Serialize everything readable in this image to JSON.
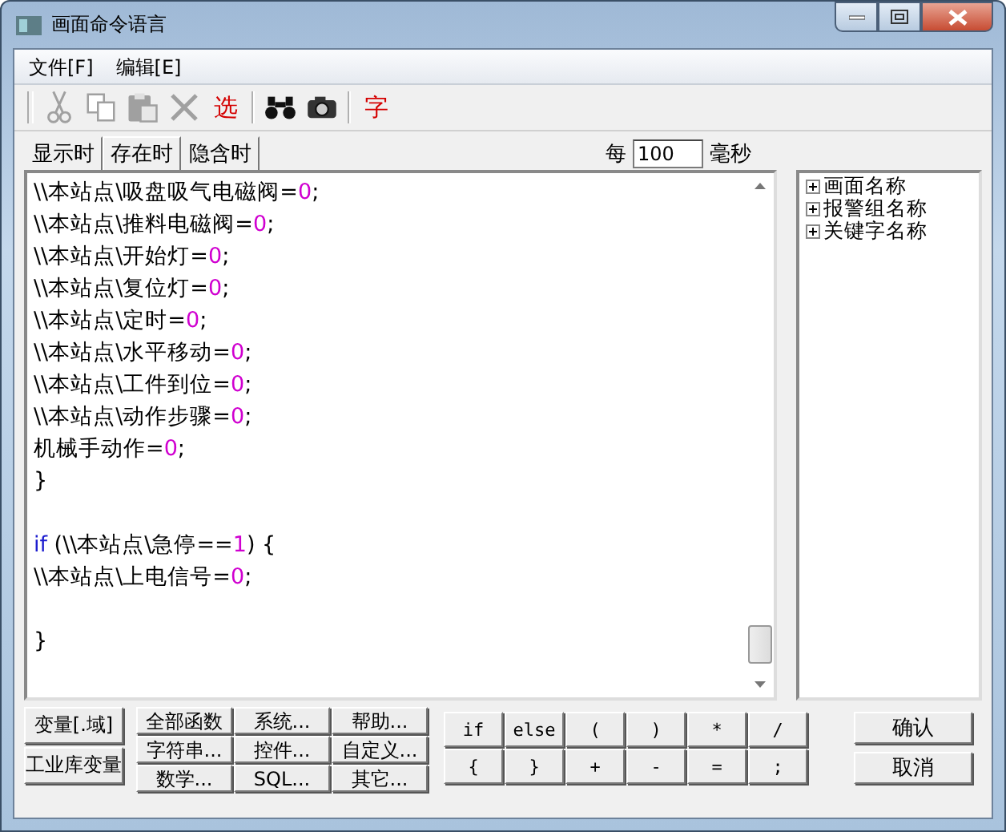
{
  "window": {
    "title": "画面命令语言"
  },
  "menu": [
    {
      "label": "文件[F]"
    },
    {
      "label": "编辑[E]"
    }
  ],
  "toolbar": [
    {
      "kind": "cut",
      "disabled": true
    },
    {
      "kind": "copy",
      "disabled": true
    },
    {
      "kind": "paste",
      "disabled": true
    },
    {
      "kind": "delete",
      "disabled": true
    },
    {
      "kind": "text",
      "label": "选"
    },
    {
      "kind": "separator"
    },
    {
      "kind": "find"
    },
    {
      "kind": "camera"
    },
    {
      "kind": "separator"
    },
    {
      "kind": "text",
      "label": "字"
    }
  ],
  "tabs": [
    {
      "label": "显示时",
      "selected": false
    },
    {
      "label": "存在时",
      "selected": true
    },
    {
      "label": "隐含时",
      "selected": false
    }
  ],
  "interval": {
    "prefix": "每",
    "value": "100",
    "unit": "毫秒"
  },
  "code_lines": [
    {
      "kind": "code",
      "segments": [
        {
          "kind": "text",
          "text": "\\\\本站点\\吸盘吸气电磁阀="
        },
        {
          "kind": "number",
          "text": "0"
        },
        {
          "kind": "text",
          "text": ";"
        }
      ]
    },
    {
      "kind": "code",
      "segments": [
        {
          "kind": "text",
          "text": "\\\\本站点\\推料电磁阀="
        },
        {
          "kind": "number",
          "text": "0"
        },
        {
          "kind": "text",
          "text": ";"
        }
      ]
    },
    {
      "kind": "code",
      "segments": [
        {
          "kind": "text",
          "text": "\\\\本站点\\开始灯="
        },
        {
          "kind": "number",
          "text": "0"
        },
        {
          "kind": "text",
          "text": ";"
        }
      ]
    },
    {
      "kind": "code",
      "segments": [
        {
          "kind": "text",
          "text": "\\\\本站点\\复位灯="
        },
        {
          "kind": "number",
          "text": "0"
        },
        {
          "kind": "text",
          "text": ";"
        }
      ]
    },
    {
      "kind": "code",
      "segments": [
        {
          "kind": "text",
          "text": "\\\\本站点\\定时="
        },
        {
          "kind": "number",
          "text": "0"
        },
        {
          "kind": "text",
          "text": ";"
        }
      ]
    },
    {
      "kind": "code",
      "segments": [
        {
          "kind": "text",
          "text": "\\\\本站点\\水平移动="
        },
        {
          "kind": "number",
          "text": "0"
        },
        {
          "kind": "text",
          "text": ";"
        }
      ]
    },
    {
      "kind": "code",
      "segments": [
        {
          "kind": "text",
          "text": "\\\\本站点\\工件到位="
        },
        {
          "kind": "number",
          "text": "0"
        },
        {
          "kind": "text",
          "text": ";"
        }
      ]
    },
    {
      "kind": "code",
      "segments": [
        {
          "kind": "text",
          "text": "\\\\本站点\\动作步骤="
        },
        {
          "kind": "number",
          "text": "0"
        },
        {
          "kind": "text",
          "text": ";"
        }
      ]
    },
    {
      "kind": "code",
      "segments": [
        {
          "kind": "text",
          "text": "机械手动作="
        },
        {
          "kind": "number",
          "text": "0"
        },
        {
          "kind": "text",
          "text": ";"
        }
      ]
    },
    {
      "kind": "code",
      "segments": [
        {
          "kind": "text",
          "text": "}"
        }
      ]
    },
    {
      "kind": "blank"
    },
    {
      "kind": "code",
      "segments": [
        {
          "kind": "keyword",
          "text": "if"
        },
        {
          "kind": "text",
          "text": " (\\\\本站点\\急停=="
        },
        {
          "kind": "number",
          "text": "1"
        },
        {
          "kind": "text",
          "text": ") {"
        }
      ]
    },
    {
      "kind": "code",
      "segments": [
        {
          "kind": "text",
          "text": "\\\\本站点\\上电信号="
        },
        {
          "kind": "number",
          "text": "0"
        },
        {
          "kind": "text",
          "text": ";"
        }
      ]
    },
    {
      "kind": "blank"
    },
    {
      "kind": "code",
      "segments": [
        {
          "kind": "text",
          "text": "}"
        }
      ]
    }
  ],
  "tree": [
    {
      "label": "画面名称",
      "expanded": false
    },
    {
      "label": "报警组名称",
      "expanded": false
    },
    {
      "label": "关键字名称",
      "expanded": false
    }
  ],
  "variable_buttons": [
    "变量[.域]",
    "工业库变量"
  ],
  "function_buttons": [
    "全部函数",
    "系统...",
    "帮助...",
    "字符串...",
    "控件...",
    "自定义...",
    "数学...",
    "SQL...",
    "其它..."
  ],
  "operator_buttons": [
    "if",
    "else",
    "(",
    ")",
    "*",
    "/",
    "{",
    "}",
    "+",
    "-",
    "=",
    ";"
  ],
  "dialog_buttons": [
    "确认",
    "取消"
  ]
}
